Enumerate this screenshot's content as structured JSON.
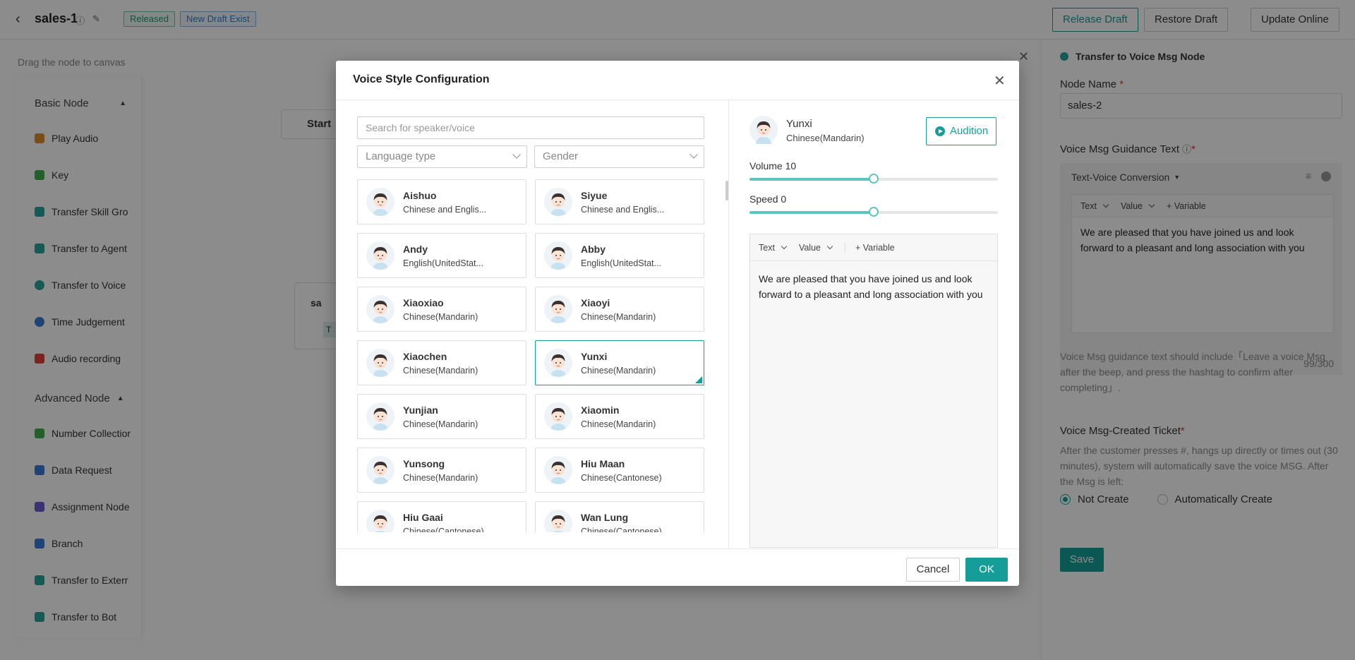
{
  "header": {
    "title": "sales-1",
    "status_released": "Released",
    "status_draft": "New Draft Exist",
    "release_draft": "Release Draft",
    "restore_draft": "Restore Draft",
    "update_online": "Update Online"
  },
  "left_panel": {
    "hint": "Drag the node to canvas",
    "basic_group": "Basic Node",
    "basic_items": [
      "Play Audio",
      "Key",
      "Transfer Skill Gro",
      "Transfer to Agent",
      "Transfer to Voice",
      "Time Judgement",
      "Audio recording"
    ],
    "advanced_group": "Advanced Node",
    "advanced_items": [
      "Number Collectior",
      "Data Request",
      "Assignment Node",
      "Branch",
      "Transfer to Exterr",
      "Transfer to Bot"
    ]
  },
  "canvas": {
    "start_label": "Start",
    "node_label_fragment": "sa",
    "node_tag_fragment": "T"
  },
  "right_panel": {
    "title": "Transfer to Voice Msg Node",
    "node_name_label": "Node Name",
    "node_name_value": "sales-2",
    "guidance_label": "Voice Msg Guidance Text",
    "mode_label": "Text-Voice Conversion",
    "toolbar_text": "Text",
    "toolbar_value": "Value",
    "toolbar_variable": "Variable",
    "guidance_text": "We are pleased that you have joined us and look forward to a pleasant and long association with you",
    "counter": "99/300",
    "guidance_hint": "Voice Msg guidance text should include「Leave a voice Msg after the beep, and press the hashtag to confirm after completing」.",
    "ticket_label": "Voice Msg-Created Ticket",
    "ticket_hint": "After the customer presses #, hangs up directly or times out (30 minutes), system will automatically save the voice MSG. After the Msg is left:",
    "option_not_create": "Not Create",
    "option_auto_create": "Automatically Create",
    "save": "Save"
  },
  "modal": {
    "title": "Voice Style Configuration",
    "search_placeholder": "Search for speaker/voice",
    "language_placeholder": "Language type",
    "gender_placeholder": "Gender",
    "speakers": [
      {
        "name": "Aishuo",
        "lang": "Chinese and Englis..."
      },
      {
        "name": "Siyue",
        "lang": "Chinese and Englis..."
      },
      {
        "name": "Andy",
        "lang": "English(UnitedStat..."
      },
      {
        "name": "Abby",
        "lang": "English(UnitedStat..."
      },
      {
        "name": "Xiaoxiao",
        "lang": "Chinese(Mandarin)"
      },
      {
        "name": "Xiaoyi",
        "lang": "Chinese(Mandarin)"
      },
      {
        "name": "Xiaochen",
        "lang": "Chinese(Mandarin)"
      },
      {
        "name": "Yunxi",
        "lang": "Chinese(Mandarin)"
      },
      {
        "name": "Yunjian",
        "lang": "Chinese(Mandarin)"
      },
      {
        "name": "Xiaomin",
        "lang": "Chinese(Mandarin)"
      },
      {
        "name": "Yunsong",
        "lang": "Chinese(Mandarin)"
      },
      {
        "name": "Hiu Maan",
        "lang": "Chinese(Cantonese)"
      },
      {
        "name": "Hiu Gaai",
        "lang": "Chinese(Cantonese)"
      },
      {
        "name": "Wan Lung",
        "lang": "Chinese(Cantonese)"
      }
    ],
    "selected": {
      "name": "Yunxi",
      "lang": "Chinese(Mandarin)"
    },
    "audition": "Audition",
    "volume_label": "Volume 10",
    "volume_level": 0.5,
    "speed_label": "Speed 0",
    "speed_level": 0.5,
    "toolbar_text": "Text",
    "toolbar_value": "Value",
    "toolbar_variable": "Variable",
    "text": "We are pleased that you have joined us and look forward to a pleasant and long association with you",
    "cancel": "Cancel",
    "ok": "OK"
  },
  "colors": {
    "accent": "#159e99",
    "released": "#1f9b6f",
    "draft": "#2f7fc6"
  }
}
